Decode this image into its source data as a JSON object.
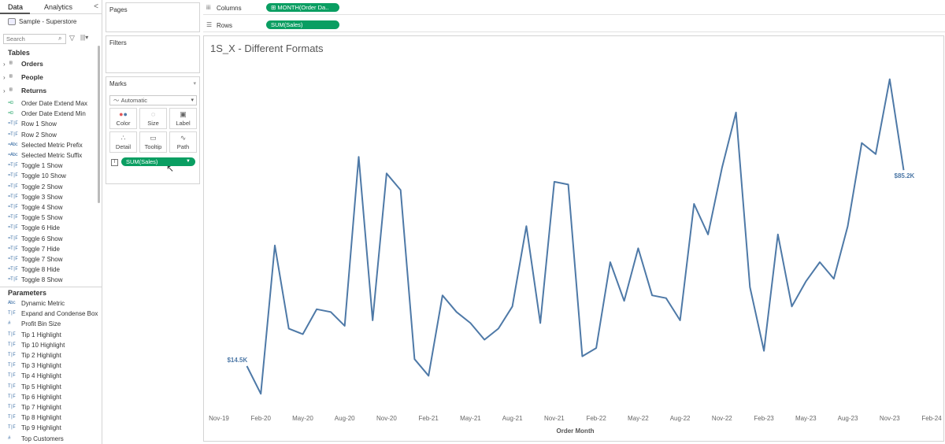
{
  "data_pane": {
    "tabs": [
      "Data",
      "Analytics"
    ],
    "collapse": "<",
    "datasource": "Sample - Superstore",
    "search_placeholder": "Search",
    "tables_header": "Tables",
    "tables": [
      "Orders",
      "People",
      "Returns"
    ],
    "fields": [
      {
        "type": "=⊡",
        "name": "Order Date Extend Max"
      },
      {
        "type": "=⊡",
        "name": "Order Date Extend Min"
      },
      {
        "type": "=T|F",
        "name": "Row 1 Show"
      },
      {
        "type": "=T|F",
        "name": "Row 2 Show"
      },
      {
        "type": "=Abc",
        "name": "Selected Metric Prefix"
      },
      {
        "type": "=Abc",
        "name": "Selected Metric Suffix"
      },
      {
        "type": "=T|F",
        "name": "Toggle 1 Show"
      },
      {
        "type": "=T|F",
        "name": "Toggle 10 Show"
      },
      {
        "type": "=T|F",
        "name": "Toggle 2 Show"
      },
      {
        "type": "=T|F",
        "name": "Toggle 3 Show"
      },
      {
        "type": "=T|F",
        "name": "Toggle 4 Show"
      },
      {
        "type": "=T|F",
        "name": "Toggle 5 Show"
      },
      {
        "type": "=T|F",
        "name": "Toggle 6 Hide"
      },
      {
        "type": "=T|F",
        "name": "Toggle 6 Show"
      },
      {
        "type": "=T|F",
        "name": "Toggle 7 Hide"
      },
      {
        "type": "=T|F",
        "name": "Toggle 7 Show"
      },
      {
        "type": "=T|F",
        "name": "Toggle 8 Hide"
      },
      {
        "type": "=T|F",
        "name": "Toggle 8 Show"
      }
    ],
    "parameters_header": "Parameters",
    "parameters": [
      {
        "type": "Abc",
        "name": "Dynamic Metric"
      },
      {
        "type": "T|F",
        "name": "Expand and Condense Box"
      },
      {
        "type": "#",
        "name": "Profit Bin Size"
      },
      {
        "type": "T|F",
        "name": "Tip 1 Highlight"
      },
      {
        "type": "T|F",
        "name": "Tip 10 Highlight"
      },
      {
        "type": "T|F",
        "name": "Tip 2 Highlight"
      },
      {
        "type": "T|F",
        "name": "Tip 3 Highlight"
      },
      {
        "type": "T|F",
        "name": "Tip 4 Highlight"
      },
      {
        "type": "T|F",
        "name": "Tip 5 Highlight"
      },
      {
        "type": "T|F",
        "name": "Tip 6 Highlight"
      },
      {
        "type": "T|F",
        "name": "Tip 7 Highlight"
      },
      {
        "type": "T|F",
        "name": "Tip 8 Highlight"
      },
      {
        "type": "T|F",
        "name": "Tip 9 Highlight"
      },
      {
        "type": "#",
        "name": "Top Customers"
      }
    ]
  },
  "cards": {
    "pages": "Pages",
    "filters": "Filters",
    "marks": "Marks",
    "mark_type": "Automatic",
    "buttons": [
      "Color",
      "Size",
      "Label",
      "Detail",
      "Tooltip",
      "Path"
    ],
    "label_pill": "SUM(Sales)"
  },
  "shelves": {
    "columns_label": "Columns",
    "columns_pill": "MONTH(Order Da..",
    "rows_label": "Rows",
    "rows_pill": "SUM(Sales)"
  },
  "viz": {
    "title": "1S_X - Different Formats",
    "start_label": "$14.5K",
    "end_label": "$85.2K"
  },
  "colors": {
    "line": "#4e79a7",
    "pill": "#0a9e62"
  },
  "chart_data": {
    "type": "line",
    "title": "1S_X - Different Formats",
    "xlabel": "Order Month",
    "ylabel": "",
    "x_ticks": [
      "Nov-19",
      "Feb-20",
      "May-20",
      "Aug-20",
      "Nov-20",
      "Feb-21",
      "May-21",
      "Aug-21",
      "Nov-21",
      "Feb-22",
      "May-22",
      "Aug-22",
      "Nov-22",
      "Feb-23",
      "May-23",
      "Aug-23",
      "Nov-23",
      "Feb-24"
    ],
    "x": [
      "Jan-20",
      "Feb-20",
      "Mar-20",
      "Apr-20",
      "May-20",
      "Jun-20",
      "Jul-20",
      "Aug-20",
      "Sep-20",
      "Oct-20",
      "Nov-20",
      "Dec-20",
      "Jan-21",
      "Feb-21",
      "Mar-21",
      "Apr-21",
      "May-21",
      "Jun-21",
      "Jul-21",
      "Aug-21",
      "Sep-21",
      "Oct-21",
      "Nov-21",
      "Dec-21",
      "Jan-22",
      "Feb-22",
      "Mar-22",
      "Apr-22",
      "May-22",
      "Jun-22",
      "Jul-22",
      "Aug-22",
      "Sep-22",
      "Oct-22",
      "Nov-22",
      "Dec-22",
      "Jan-23",
      "Feb-23",
      "Mar-23",
      "Apr-23",
      "May-23",
      "Jun-23",
      "Jul-23",
      "Aug-23",
      "Sep-23",
      "Oct-23",
      "Nov-23",
      "Dec-23"
    ],
    "series": [
      {
        "values": [
          14.5,
          4.5,
          58.0,
          28.0,
          26.0,
          35.0,
          34.0,
          29.0,
          90.0,
          31.0,
          84.0,
          78.0,
          17.0,
          11.0,
          40.0,
          34.0,
          30.0,
          24.0,
          28.0,
          36.0,
          65.0,
          30.0,
          81.0,
          80.0,
          18.0,
          21.0,
          52.0,
          38.0,
          57.0,
          40.0,
          39.0,
          31.0,
          73.0,
          62.0,
          86.0,
          106.0,
          43.0,
          20.0,
          62.0,
          36.0,
          45.0,
          52.0,
          46.0,
          65.0,
          95.0,
          91.0,
          118.0,
          85.2
        ]
      }
    ],
    "ylim": [
      0,
      125
    ],
    "grid": false,
    "data_labels": [
      "$14.5K",
      "$85.2K"
    ]
  }
}
